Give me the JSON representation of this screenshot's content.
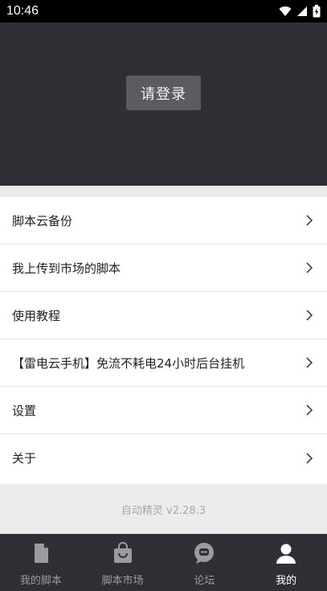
{
  "status_bar": {
    "time": "10:46",
    "icons": [
      "wifi-icon",
      "cell-signal-icon",
      "battery-charging-icon"
    ]
  },
  "header": {
    "login_label": "请登录"
  },
  "menu": {
    "items": [
      {
        "label": "脚本云备份",
        "icon": "chevron-right-icon"
      },
      {
        "label": "我上传到市场的脚本",
        "icon": "chevron-right-icon"
      },
      {
        "label": "使用教程",
        "icon": "chevron-right-icon"
      },
      {
        "label": "【雷电云手机】免流不耗电24小时后台挂机",
        "icon": "chevron-right-icon"
      },
      {
        "label": "设置",
        "icon": "chevron-right-icon"
      },
      {
        "label": "关于",
        "icon": "chevron-right-icon"
      }
    ]
  },
  "footer": {
    "version": "自动精灵 v2.28.3"
  },
  "bottom_nav": {
    "active_index": 3,
    "items": [
      {
        "label": "我的脚本",
        "icon": "document-icon"
      },
      {
        "label": "脚本市场",
        "icon": "shopping-bag-icon"
      },
      {
        "label": "论坛",
        "icon": "chat-bubble-icon"
      },
      {
        "label": "我的",
        "icon": "person-icon"
      }
    ]
  },
  "colors": {
    "header_bg": "#2f3036",
    "login_button_bg": "#5b5c60",
    "nav_active": "#ffffff",
    "nav_inactive": "#9c9c9f"
  }
}
